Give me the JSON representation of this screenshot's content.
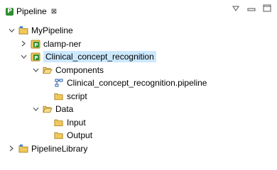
{
  "tab": {
    "title": "Pipeline",
    "close_glyph": "⊠",
    "icon": "P"
  },
  "toolbar": {
    "view_menu_glyph": "▽",
    "minimize_glyph": "▭",
    "maximize_glyph": "□"
  },
  "tree": {
    "items": [
      {
        "label": "MyPipeline",
        "expanded": true,
        "icon": "project-folder-icon"
      },
      {
        "label": "clamp-ner",
        "expanded": false,
        "icon": "pipeline-project-icon"
      },
      {
        "label": "Clinical_concept_recognition",
        "expanded": true,
        "icon": "pipeline-project-icon",
        "selected": true
      },
      {
        "label": "Components",
        "expanded": true,
        "icon": "folder-icon"
      },
      {
        "label": "Clinical_concept_recognition.pipeline",
        "icon": "pipeline-file-icon"
      },
      {
        "label": "script",
        "icon": "folder-icon"
      },
      {
        "label": "Data",
        "expanded": true,
        "icon": "folder-icon"
      },
      {
        "label": "Input",
        "icon": "folder-icon"
      },
      {
        "label": "Output",
        "icon": "folder-icon"
      },
      {
        "label": "PipelineLibrary",
        "expanded": false,
        "icon": "project-folder-icon"
      }
    ]
  },
  "colors": {
    "selection": "#cce8ff",
    "folder": "#e9c46a",
    "pipeline_badge": "#2f8f2f"
  }
}
